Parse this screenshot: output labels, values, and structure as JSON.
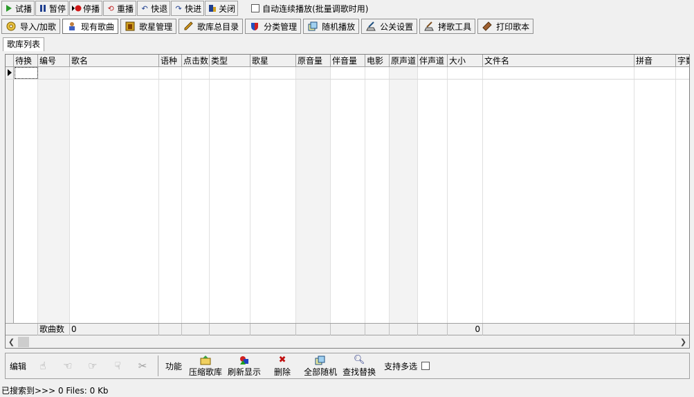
{
  "playbar": {
    "buttons": [
      {
        "label": "试播"
      },
      {
        "label": "暂停"
      },
      {
        "label": "停播"
      },
      {
        "label": "重播"
      },
      {
        "label": "快退"
      },
      {
        "label": "快进"
      },
      {
        "label": "关闭"
      }
    ],
    "auto_label": "自动连续播放(批量调歌时用)"
  },
  "main_tabs": [
    {
      "label": "导入/加歌"
    },
    {
      "label": "现有歌曲"
    },
    {
      "label": "歌星管理"
    },
    {
      "label": "歌库总目录"
    },
    {
      "label": "分类管理"
    },
    {
      "label": "随机播放"
    },
    {
      "label": "公关设置"
    },
    {
      "label": "拷歌工具"
    },
    {
      "label": "打印歌本"
    }
  ],
  "sub_tab": "歌库列表",
  "grid": {
    "columns": [
      "待换",
      "编号",
      "歌名",
      "语种",
      "点击数",
      "类型",
      "歌星",
      "原音量",
      "伴音量",
      "电影",
      "原声道",
      "伴声道",
      "大小",
      "文件名",
      "拼音",
      "字数"
    ],
    "footer": {
      "label": "歌曲数",
      "count": "0",
      "size_total": "0"
    }
  },
  "fnbar": {
    "edit_label": "编辑",
    "func_label": "功能",
    "buttons": [
      {
        "label": "压缩歌库"
      },
      {
        "label": "刷新显示"
      },
      {
        "label": "删除"
      },
      {
        "label": "全部随机"
      },
      {
        "label": "查找替换"
      }
    ],
    "multi_label": "支持多选"
  },
  "status": "已搜索到>>> 0 Files: 0 Kb"
}
